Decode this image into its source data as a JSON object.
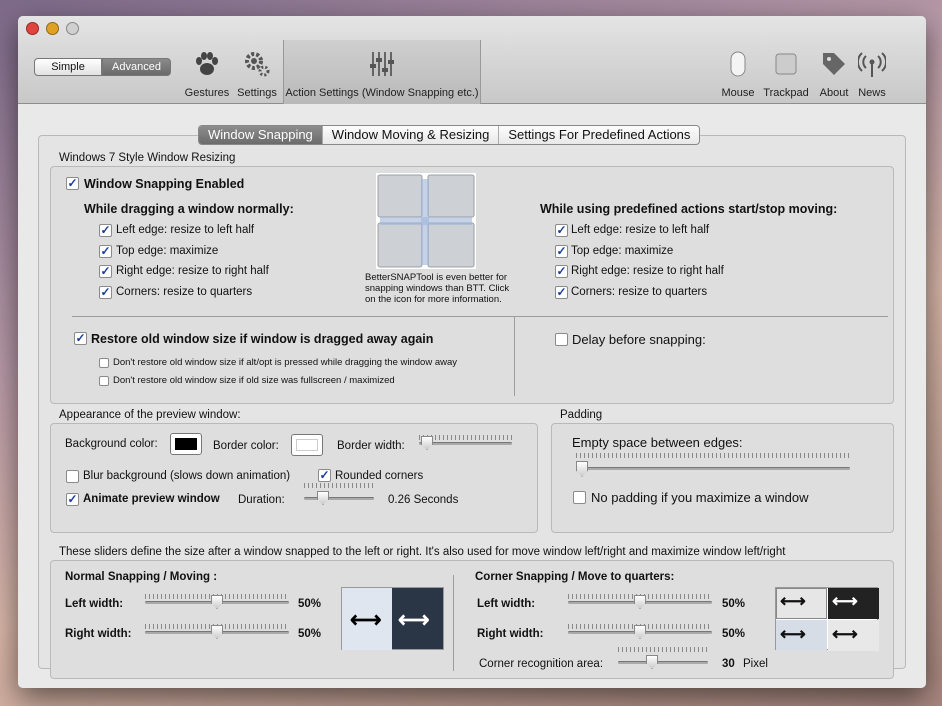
{
  "toolbar": {
    "simple_label": "Simple",
    "advanced_label": "Advanced",
    "items": [
      {
        "label": "Gestures",
        "icon": "paw-icon"
      },
      {
        "label": "Settings",
        "icon": "gears-icon"
      },
      {
        "label": "Action Settings (Window Snapping etc.)",
        "icon": "sliders-icon"
      },
      {
        "label": "Mouse",
        "icon": "mouse-icon"
      },
      {
        "label": "Trackpad",
        "icon": "trackpad-icon"
      },
      {
        "label": "About",
        "icon": "tag-icon"
      },
      {
        "label": "News",
        "icon": "antenna-icon"
      }
    ]
  },
  "tabs": [
    "Window Snapping",
    "Window Moving & Resizing",
    "Settings For Predefined Actions"
  ],
  "resizing": {
    "title": "Windows 7 Style Window Resizing",
    "enabled_label": "Window Snapping Enabled",
    "dragging_heading": "While dragging a window normally:",
    "predefined_heading": "While using predefined actions start/stop moving:",
    "options": [
      "Left edge: resize to left half",
      "Top edge: maximize",
      "Right edge: resize to right half",
      "Corners: resize to quarters"
    ],
    "promo": "BetterSNAPTool is even better for snapping windows than BTT. Click on the icon for more information.",
    "restore_label": "Restore old window size if window is dragged away again",
    "restore_sub1": "Don't restore old window size if alt/opt is pressed while dragging the window away",
    "restore_sub2": "Don't restore old window size if old size was fullscreen / maximized",
    "delay_label": "Delay before snapping:"
  },
  "appearance": {
    "title": "Appearance of the preview window:",
    "bg_label": "Background color:",
    "bg_color": "#000000",
    "border_label": "Border color:",
    "border_color": "#ffffff",
    "width_label": "Border width:",
    "blur_label": "Blur background (slows down animation)",
    "rounded_label": "Rounded corners",
    "animate_label": "Animate preview window",
    "duration_label": "Duration:",
    "duration_value": "0.26 Seconds"
  },
  "padding": {
    "title": "Padding",
    "empty_label": "Empty space between edges:",
    "nopad_label": "No padding if you maximize a window"
  },
  "sizes": {
    "description": "These sliders define the size after a window snapped to the left or right. It's also used for move window left/right and maximize window left/right",
    "normal_title": "Normal Snapping / Moving :",
    "corner_title": "Corner Snapping / Move to quarters:",
    "left_label": "Left width:",
    "right_label": "Right width:",
    "n_left": "50%",
    "n_right": "50%",
    "c_left": "50%",
    "c_right": "50%",
    "corner_area_label": "Corner recognition area:",
    "corner_area_value": "30",
    "corner_area_unit": "Pixel"
  }
}
